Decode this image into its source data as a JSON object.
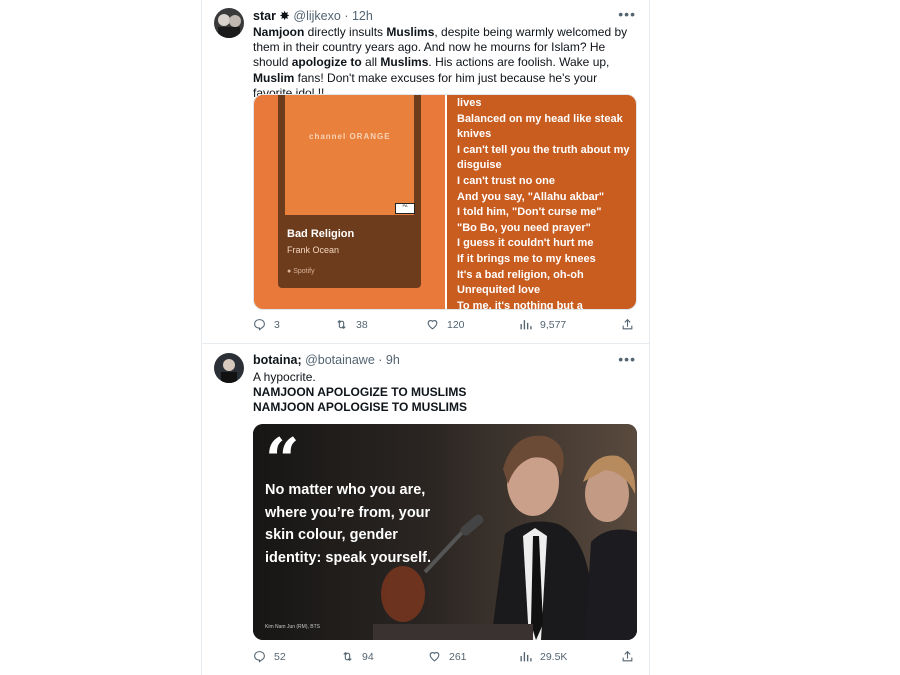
{
  "tweets": [
    {
      "display_name": "star",
      "name_symbol": "✸",
      "handle": "@lijkexo",
      "time": "12h",
      "text_segments": [
        {
          "t": "Namjoon",
          "b": true
        },
        {
          "t": " directly insults ",
          "b": false
        },
        {
          "t": "Muslims",
          "b": true
        },
        {
          "t": ", despite being warmly welcomed by them in their country years ago. And now he mourns for Islam? He should ",
          "b": false
        },
        {
          "t": "apologize to",
          "b": true
        },
        {
          "t": " all ",
          "b": false
        },
        {
          "t": "Muslims",
          "b": true
        },
        {
          "t": ". His actions are foolish. Wake up, ",
          "b": false
        },
        {
          "t": "Muslim",
          "b": true
        },
        {
          "t": " fans! Don't make excuses for him just because he's your favorite idol !!",
          "b": false
        }
      ],
      "media": {
        "album_title": "channel ORANGE",
        "song": "Bad Religion",
        "artist": "Frank Ocean",
        "source": "Spotify",
        "lyrics": [
          "lives",
          "Balanced on my head like steak knives",
          "I can't tell you the truth about my disguise",
          "I can't trust no one",
          "And you say, \"Allahu akbar\"",
          "I told him, \"Don't curse me\"",
          "\"Bo Bo, you need prayer\"",
          "I guess it couldn't hurt me",
          "If it brings me to my knees",
          "It's a bad religion, oh-oh",
          "Unrequited love",
          "To me, it's nothing but a"
        ]
      },
      "stats": {
        "replies": "3",
        "retweets": "38",
        "likes": "120",
        "views": "9,577"
      }
    },
    {
      "display_name": "botaina;",
      "handle": "@botainawe",
      "time": "9h",
      "lines": [
        "A hypocrite.",
        "NAMJOON APOLOGIZE TO MUSLIMS",
        "NAMJOON APOLOGISE TO MUSLIMS"
      ],
      "media": {
        "quote_mark": "“",
        "quote": "No matter who you are, where you’re from, your skin colour, gender identity: speak yourself.",
        "credit": "Kim Nam Jun (RM), BTS"
      },
      "stats": {
        "replies": "52",
        "retweets": "94",
        "likes": "261",
        "views": "29.5K"
      }
    }
  ],
  "more_label": "•••",
  "separator": "·",
  "colors": {
    "muted": "#536471",
    "divider": "#e6ecf0",
    "album_orange": "#e9793a",
    "lyrics_orange": "#c95c1f"
  },
  "icons": [
    "reply-icon",
    "retweet-icon",
    "like-icon",
    "views-icon",
    "share-icon"
  ]
}
